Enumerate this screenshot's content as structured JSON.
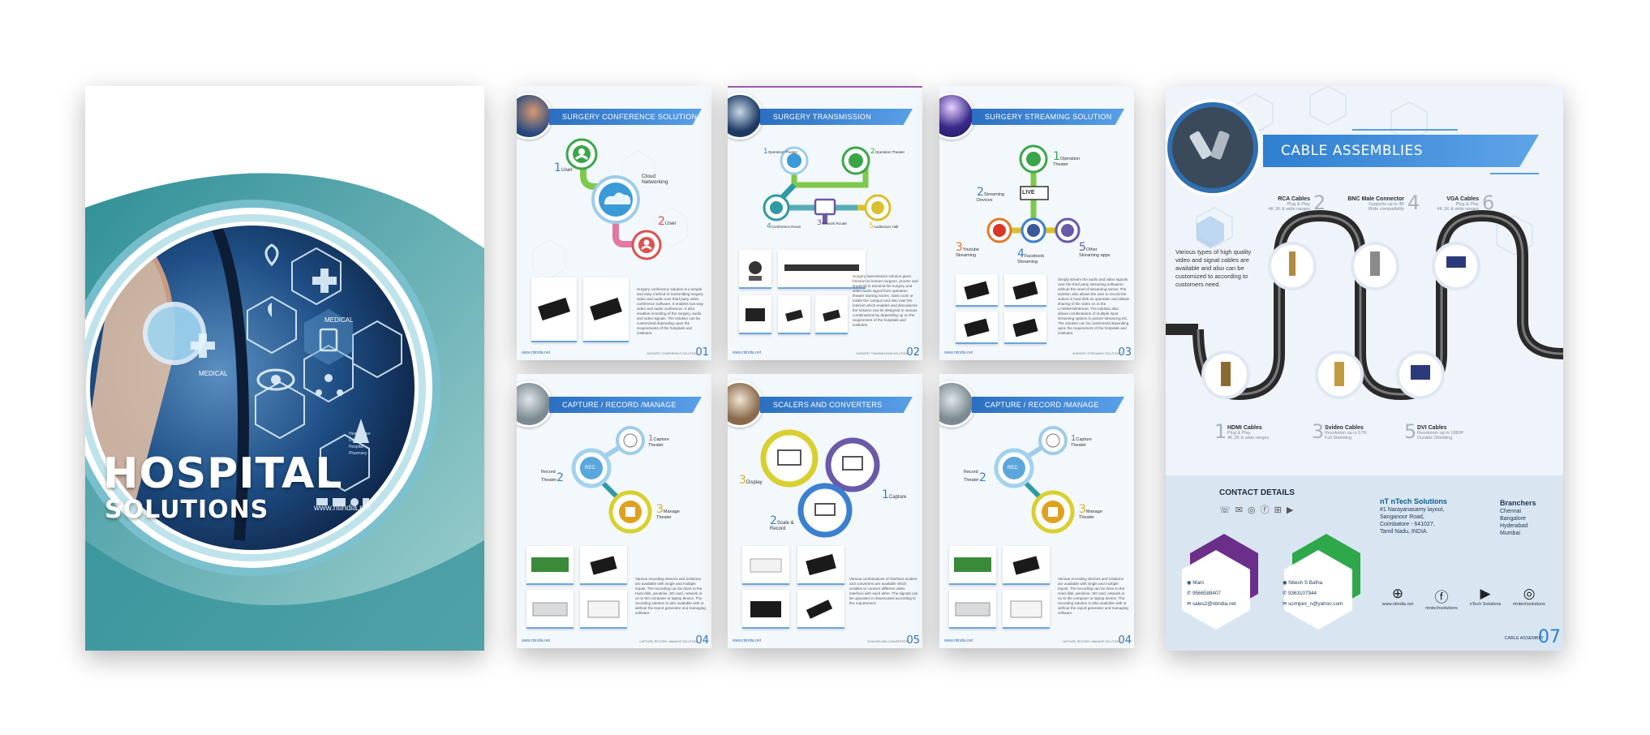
{
  "cover": {
    "title_line1": "HOSPITAL",
    "title_line2": "SOLUTIONS",
    "website": "www.ntindia.net",
    "medical_label_1": "MEDICAL",
    "medical_label_2": "MEDICAL"
  },
  "pages": {
    "p1": {
      "title": "SURGERY CONFERENCE  SOLUTION",
      "label_user1": "User",
      "n1": "1",
      "label_cloud_1": "Cloud",
      "label_cloud_2": "Networking",
      "label_user2": "User",
      "n2": "2",
      "desc": "Surgery conference solution is a simple and easy method of transmitting surgery video and audio over third party video conference software. It enables two-way video and audio conference. It also enables recording of the surgery, audio and video signals. The solution can be customized depending upon the requirements of the hospitals and institutes.",
      "web": "www.ntindia.net",
      "footer": "SURGERY CONFERENCE SOLUTION",
      "num": "01"
    },
    "p2": {
      "title": "SURGERY TRANSMISSION SOLUTION",
      "n1": "1",
      "l1": "Operation Theater",
      "n2": "2",
      "l2": "Operation Theater",
      "n3": "3",
      "l3": "Network Router",
      "n4": "4",
      "l4": "Conference Room",
      "n5": "5",
      "l5": "Auditorium Hall",
      "desc": "Surgery transmission solution gives freedom to lecture surgeon, proctor and students to transmit the surgery and video audio signal from operation theater training rooms, class room or inside the campus and also over the internet which enables and discussions the solution can be designed in various combinations by depending up on the requirement of the hospitals and institutes.",
      "web": "www.ntindia.net",
      "footer": "SURGERY TRANSMISSION SOLUTION",
      "num": "02"
    },
    "p3": {
      "title": "SURGERY STREAMING  SOLUTION",
      "n1": "1",
      "l1a": "Operation",
      "l1b": "Theater",
      "n2": "2",
      "l2a": "Streaming",
      "l2b": "Devices",
      "live": "LIVE",
      "n3": "3",
      "l3a": "Youtube",
      "l3b": "Streaming",
      "n4": "4",
      "l4a": "Facebook",
      "l4b": "Streaming",
      "n5": "5",
      "l5a": "Other",
      "l5b": "Streaming apps",
      "desc": "Simply stream the audio and video signals over the third party streaming softwares without the need of streaming server. The solution also allows the user to record the videos in hard disk on operation and allows sharing of the video on to the LAN/WAN/Internet. The solution also allows combinations of multiple input streaming options in picture streaming etc. The solution can be customized depending upon the requirement of the hospitals and institutes.",
      "web": "www.ntindia.net",
      "footer": "SURGERY STREAMING SOLUTION",
      "num": "03"
    },
    "p4": {
      "title": "CAPTURE / RECORD /MANAGE SOLUTION",
      "rec": "REC",
      "n1": "1",
      "l1a": "Capture",
      "l1b": "Theater",
      "n2": "2",
      "l2a": "Record",
      "l2b": "Theater",
      "n3": "3",
      "l3a": "Manage",
      "l3b": "Theater",
      "desc": "Various recording devices and solutions are available with single and multiple inputs. The recording can be done to the Hard disk, pendrive, SD card, network or on to the computer or laptop device. The recording solution is also available with or without the report generator and managing software.",
      "web": "www.ntindia.net",
      "footer": "CAPTURE, RECORD / MANAGE SOLUTION",
      "num": "04"
    },
    "p5": {
      "title": "SCALERS AND CONVERTERS",
      "n1": "1",
      "l1": "Capture",
      "n2": "2",
      "l2a": "Scale &",
      "l2b": "Record",
      "n3": "3",
      "l3": "Display",
      "desc": "Various combinations of interface scalers and converters are available which enables to connect different video interface with each other. The signals can be upscaled or downscaled according to the requirement.",
      "web": "www.ntindia.net",
      "footer": "SCALERS AND CONVERTERS",
      "num": "05"
    },
    "p6": {
      "title": "CAPTURE / RECORD /MANAGE SOLUTION",
      "rec": "REC",
      "n1": "1",
      "l1a": "Capture",
      "l1b": "Theater",
      "n2": "2",
      "l2a": "Record",
      "l2b": "Theater",
      "n3": "3",
      "l3a": "Manage",
      "l3b": "Theater",
      "desc": "Various recording devices and solutions are available with single and multiple inputs. The recording can be done to the Hard disk, pendrive, SD card, network or on to the computer or laptop device. The recording solution is also available with or without the report generator and managing software.",
      "web": "www.ntindia.net",
      "footer": "CAPTURE, RECORD / MANAGE SOLUTION",
      "num": "04"
    }
  },
  "cable": {
    "title": "CABLE ASSEMBLIES",
    "intro": "Various types of high quality video and signal cables are available and also can be customized to according to customers need.",
    "rca": {
      "num": "2",
      "name": "RCA Cables",
      "s1": "Plug & Play",
      "s2": "4K 2K & wide ranges"
    },
    "bnc": {
      "num": "4",
      "name": "BNC Male Connector",
      "s1": "Supports up to 4K",
      "s2": "Wide compatibility"
    },
    "vga": {
      "num": "6",
      "name": "VGA Cables",
      "s1": "Plug & Play",
      "s2": "4K 2K & wide ranges"
    },
    "hdmi": {
      "num": "1",
      "name": "HDMI Cables",
      "s1": "Plug & Play",
      "s2": "4K 2K & wide ranges"
    },
    "svideo": {
      "num": "3",
      "name": "Svideo Cables",
      "s1": "Resolution up to 576i",
      "s2": "Full Shielding"
    },
    "dvi": {
      "num": "5",
      "name": "DVI Cables",
      "s1": "Resolution up to 1080P",
      "s2": "Durable Shielding"
    },
    "contact_title": "CONTACT DETAILS",
    "company": "nT nTech Solutions",
    "addr1": "#1 Narayanasamy layout,",
    "addr2": "Sanganoor Road,",
    "addr3": "Coimbatore - 641027,",
    "addr4": "Tamil Nadu, INDIA.",
    "branches_title": "Branchers",
    "branches": [
      "Chennai",
      "Bangalore",
      "Hyderabad",
      "Mumbai"
    ],
    "c1_name": "Mani",
    "c1_phone": "9566588407",
    "c1_email": "sales2@ntindia.net",
    "c2_name": "Nitesh S Bafna",
    "c2_phone": "9363107944",
    "c2_email": "scimpex_n@yahoo.com",
    "s1": "www.ntindia.net",
    "s2": "ntntechsolutions",
    "s3": "nTech Solutions",
    "s4": "ntntechsolutions",
    "footer": "CABLE ASSEMBLY",
    "num": "07"
  },
  "colors": {
    "accent": "#3b7fd0",
    "teal": "#2f9aa2",
    "green": "#2ea84a",
    "purple": "#7b3fa0",
    "orange": "#e07b2a",
    "dark": "#1d2c3a"
  }
}
